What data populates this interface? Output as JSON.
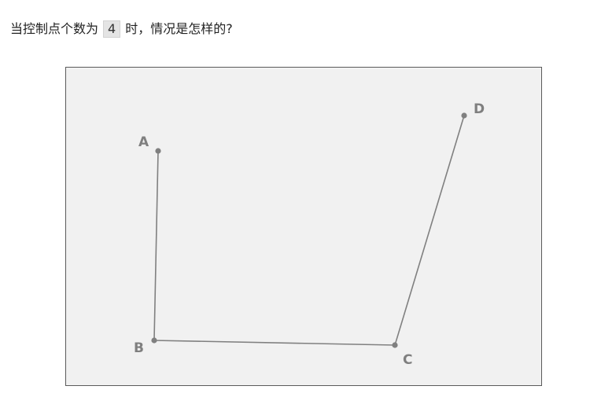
{
  "question": {
    "prefix": "当控制点个数为",
    "count": "4",
    "suffix": "时，情况是怎样的?"
  },
  "points": [
    {
      "label": "A"
    },
    {
      "label": "B"
    },
    {
      "label": "C"
    },
    {
      "label": "D"
    }
  ],
  "colors": {
    "canvas_bg": "#f1f1f1",
    "line": "#808080",
    "point": "#808080",
    "label": "#7f7f7f"
  }
}
